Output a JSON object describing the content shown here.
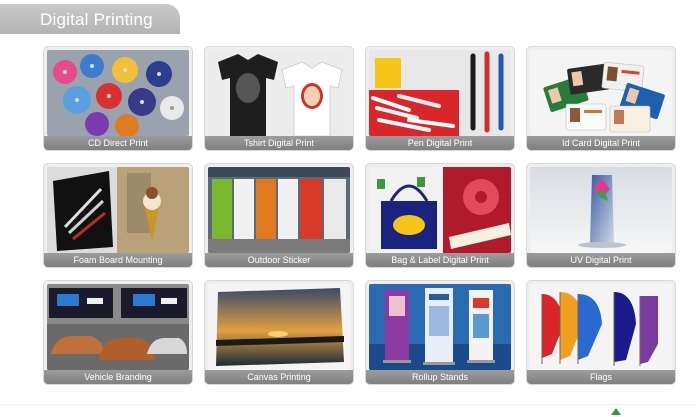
{
  "header": {
    "title": "Digital Printing"
  },
  "items": [
    {
      "label": "CD Direct Print"
    },
    {
      "label": "Tshirt Digital Print"
    },
    {
      "label": "Pen Digital Print"
    },
    {
      "label": "Id Card Digital Print"
    },
    {
      "label": "Foam Board Mounting"
    },
    {
      "label": "Outdoor Sticker"
    },
    {
      "label": "Bag & Label Digital Print"
    },
    {
      "label": "UV Digital Print"
    },
    {
      "label": "Vehicle Branding"
    },
    {
      "label": "Canvas Printing"
    },
    {
      "label": "Rollup Stands"
    },
    {
      "label": "Flags"
    }
  ],
  "colors": {
    "header_bg": "#b9b9b9",
    "caption_bg": "#8c8c8c",
    "accent": "#3a9a3a"
  }
}
